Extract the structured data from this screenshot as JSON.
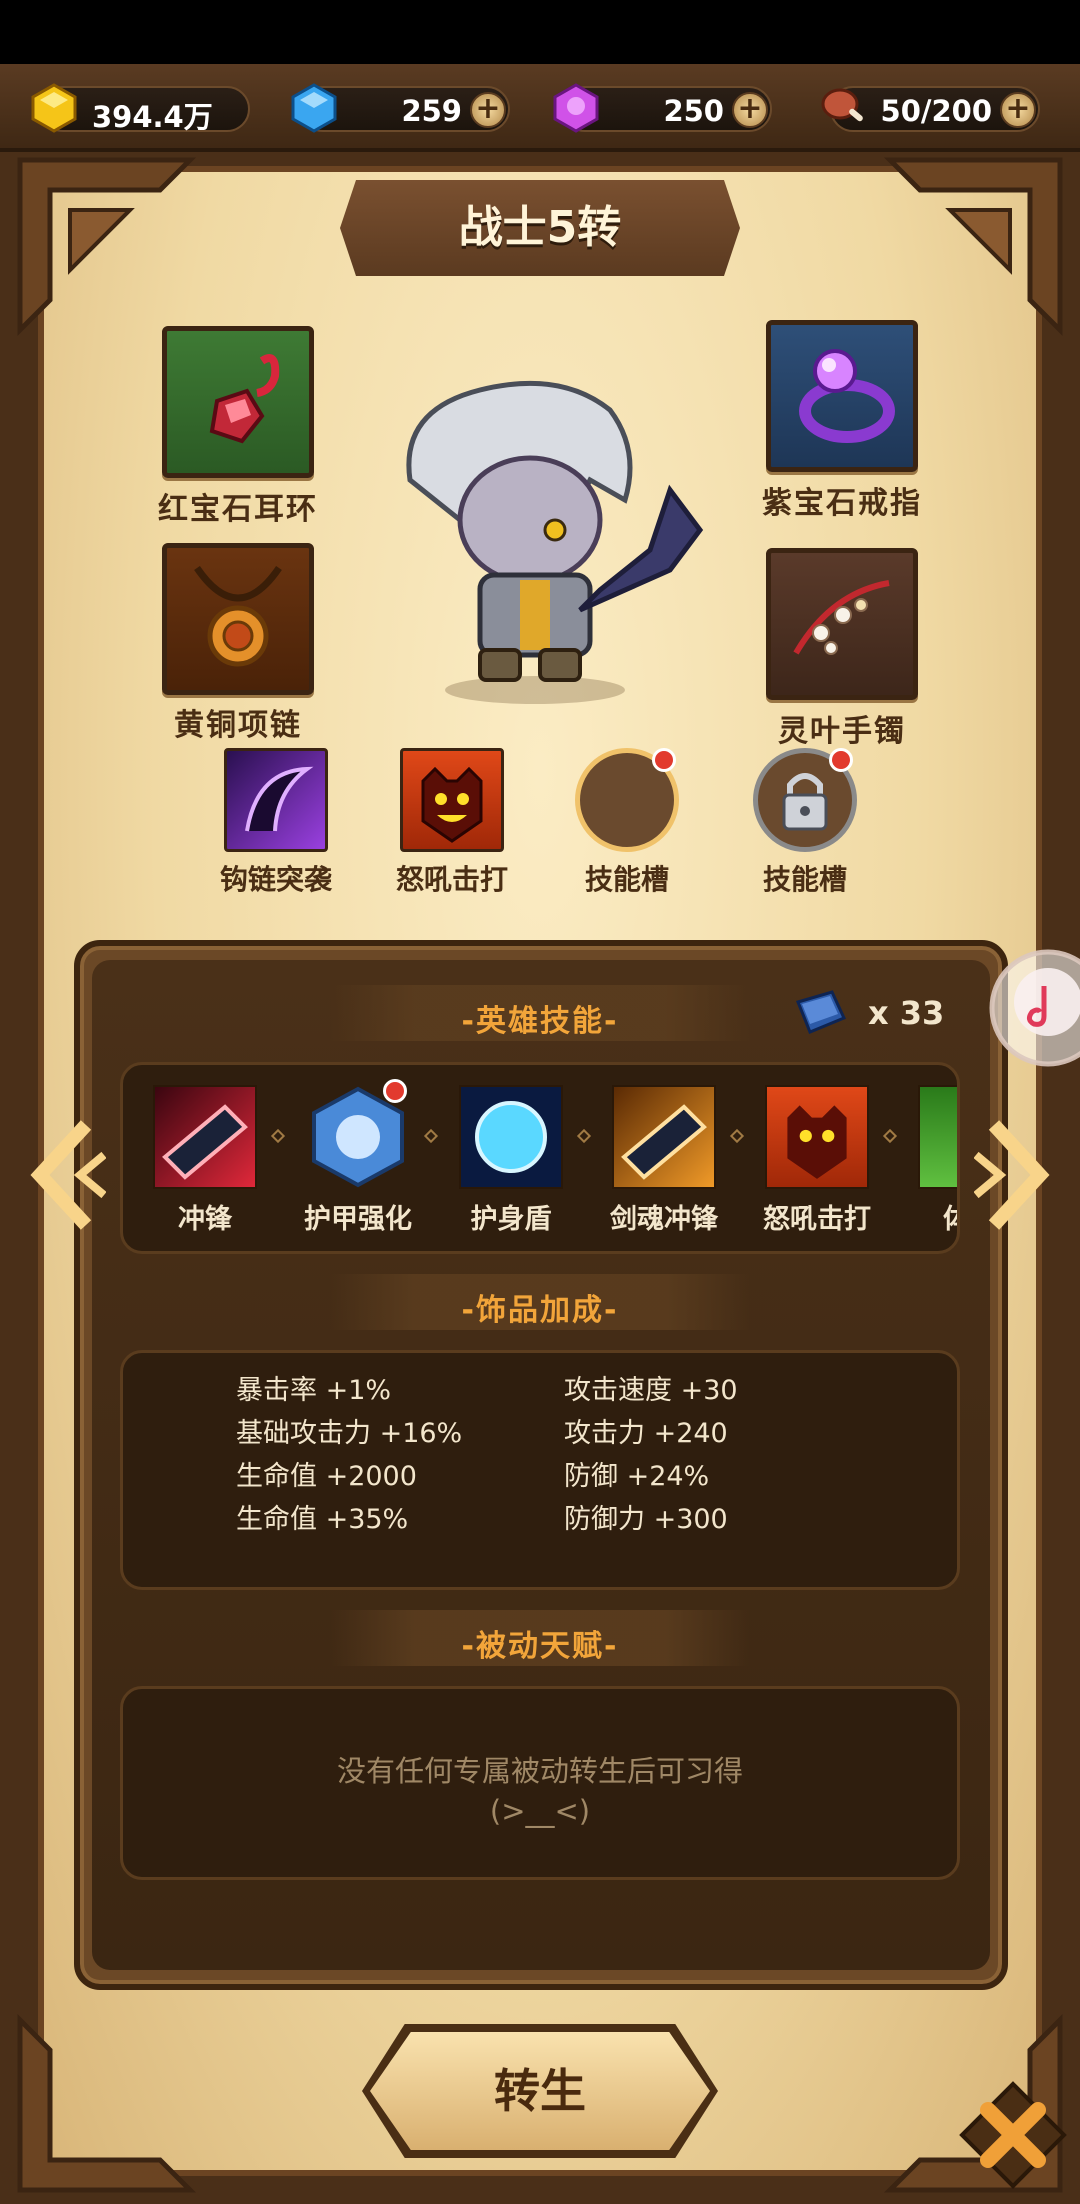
{
  "resources": {
    "gold": "394.4万",
    "diamond": "259",
    "crystal": "250",
    "stamina": "50/200",
    "plus": "+"
  },
  "title": "战士5转",
  "equipment": {
    "earring": "红宝石耳环",
    "ring": "紫宝石戒指",
    "necklace": "黄铜项链",
    "bracelet": "灵叶手镯"
  },
  "skill_slots": [
    {
      "label": "钩链突袭"
    },
    {
      "label": "怒吼击打"
    },
    {
      "label": "技能槽"
    },
    {
      "label": "技能槽"
    }
  ],
  "hero_skills": {
    "title": "-英雄技能-",
    "book_count": "x 33",
    "items": [
      {
        "label": "冲锋"
      },
      {
        "label": "护甲强化"
      },
      {
        "label": "护身盾"
      },
      {
        "label": "剑魂冲锋"
      },
      {
        "label": "怒吼击打"
      },
      {
        "label": "体质"
      }
    ]
  },
  "bonus": {
    "title": "-饰品加成-",
    "left": [
      "暴击率 +1%",
      "基础攻击力 +16%",
      "生命值 +2000",
      "生命值 +35%"
    ],
    "right": [
      "攻击速度 +30",
      "攻击力 +240",
      "防御 +24%",
      "防御力 +300"
    ]
  },
  "passive": {
    "title": "-被动天赋-",
    "line1": "没有任何专属被动转生后可习得",
    "line2": "(>__<)"
  },
  "rebirth_label": "转生",
  "colors": {
    "accent_orange": "#f2a53a",
    "parchment": "#f0d9a3",
    "wood": "#6b4826",
    "badge_red": "#e23a2e"
  }
}
